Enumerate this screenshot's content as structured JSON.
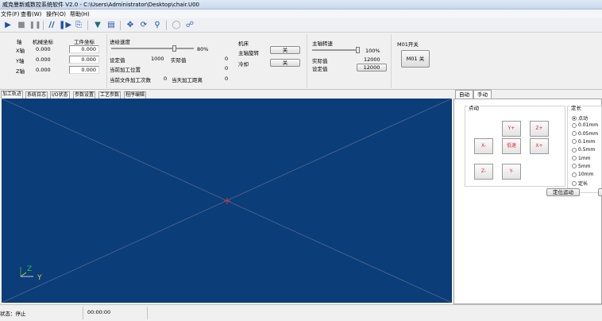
{
  "window": {
    "title": "威克曼新威数控系统软件 V2.0 - C:\\Users\\Administrator\\Desktop\\chair.U00"
  },
  "menu": [
    "文件(F)",
    "查看(W)",
    "操作(O)",
    "帮助(H)"
  ],
  "toolbar": {
    "icons": [
      "play-icon",
      "stop-icon",
      "pause-icon",
      "step-back-icon",
      "step-forward-icon",
      "file-step-icon",
      "tool-path-icon",
      "tool-path-2-icon",
      "move-icon",
      "rotate-icon",
      "zoom-icon",
      "circle-icon",
      "reset-view-icon"
    ]
  },
  "axes_panel": {
    "header_axis": "轴",
    "header_machine": "机械坐标",
    "header_work": "工件坐标",
    "rows": [
      {
        "axis": "X轴",
        "machine": "0.000",
        "work": "0.000"
      },
      {
        "axis": "Y轴",
        "machine": "0.000",
        "work": "0.000"
      },
      {
        "axis": "Z轴",
        "machine": "0.000",
        "work": "0.000"
      }
    ]
  },
  "feed_panel": {
    "title": "进给速度",
    "percent": "80%",
    "percent_value": 0.8,
    "set_label": "设定值",
    "set_value": "1000",
    "actual_label": "实际值",
    "actual_value": "0",
    "current_pos_label": "当前加工位置",
    "current_pos_value": "0",
    "file_count_label": "当前文件加工次数",
    "file_count_value": "0",
    "distance_label": "当天加工距离",
    "distance_value": "0"
  },
  "machine_panel": {
    "title": "机床",
    "spindle_label": "主轴旋转",
    "spindle_btn": "关",
    "cool_label": "冷却",
    "cool_btn": "关"
  },
  "spindle_panel": {
    "title": "主轴转速",
    "percent": "100%",
    "percent_value": 1.0,
    "actual_label": "实际值",
    "actual_value": "12000",
    "set_label": "设定值",
    "set_value": "12000"
  },
  "m01_panel": {
    "title": "M01开关",
    "btn": "M01 关"
  },
  "tabs": [
    "加工轨迹",
    "系统日志",
    "I/O状态",
    "参数设置",
    "工艺参数",
    "程序编辑"
  ],
  "canvas": {
    "axis_z": "Z",
    "axis_y": "Y",
    "axis_x": "X"
  },
  "right_tabs": [
    "自动",
    "手动"
  ],
  "jog": {
    "group_title": "点动",
    "buttons": {
      "y_plus": "Y+",
      "z_plus": "Z+",
      "x_minus": "X-",
      "low_speed": "低速",
      "x_plus": "X+",
      "z_minus": "Z-",
      "y_minus": "Y-"
    }
  },
  "step": {
    "group_title": "定长",
    "options": [
      "点动",
      "0.01mm",
      "0.05mm",
      "0.1mm",
      "0.5mm",
      "1mm",
      "5mm",
      "10mm",
      "定长"
    ],
    "selected": "点动"
  },
  "locate_button": "定位运动",
  "status": {
    "state": "状态：停止",
    "time": "00:00:00"
  }
}
